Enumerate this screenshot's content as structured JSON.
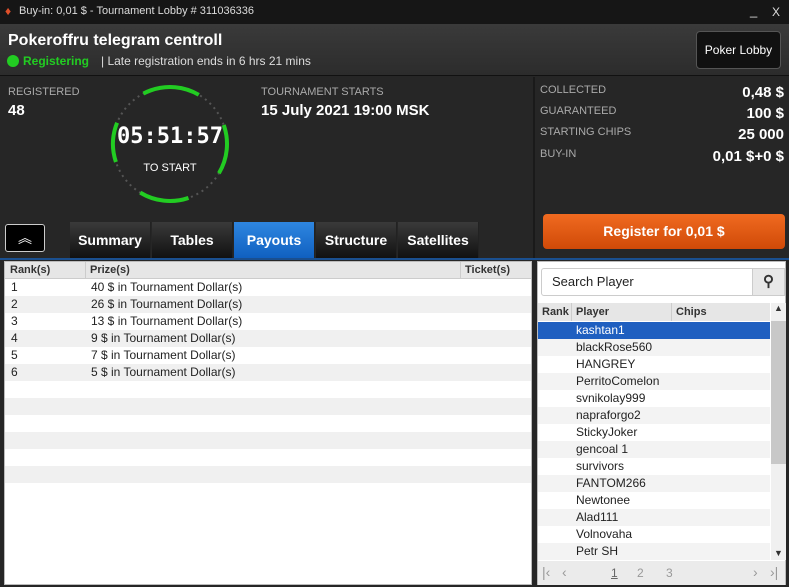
{
  "window": {
    "title": "Buy-in: 0,01 $ - Tournament Lobby # 311036336",
    "minimize": "_",
    "close": "X"
  },
  "header": {
    "name": "Pokeroffru telegram centroll",
    "status": "Registering",
    "late_reg": "| Late registration ends in 6 hrs  21 mins",
    "lobby_button": "Poker Lobby",
    "status_color": "#22cc22"
  },
  "info": {
    "registered_label": "REGISTERED",
    "registered": "48",
    "timer": "05:51:57",
    "timer_label": "TO START",
    "starts_label": "TOURNAMENT STARTS",
    "starts": "15 July 2021  19:00 MSK"
  },
  "stats": [
    {
      "label": "COLLECTED",
      "value": "0,48 $"
    },
    {
      "label": "GUARANTEED",
      "value": "100 $"
    },
    {
      "label": "STARTING CHIPS",
      "value": "25 000"
    },
    {
      "label": "BUY-IN",
      "value": "0,01 $+0 $"
    }
  ],
  "register_button": "Register for  0,01 $",
  "tabs": [
    {
      "label": "Summary"
    },
    {
      "label": "Tables"
    },
    {
      "label": "Payouts",
      "active": true
    },
    {
      "label": "Structure"
    },
    {
      "label": "Satellites"
    }
  ],
  "payouts": {
    "headers": [
      "Rank(s)",
      "Prize(s)",
      "Ticket(s)"
    ],
    "rows": [
      [
        "1",
        "40 $ in Tournament Dollar(s)"
      ],
      [
        "2",
        "26 $ in Tournament Dollar(s)"
      ],
      [
        "3",
        "13 $ in Tournament Dollar(s)"
      ],
      [
        "4",
        "9 $ in Tournament Dollar(s)"
      ],
      [
        "5",
        "7 $ in Tournament Dollar(s)"
      ],
      [
        "6",
        "5 $ in Tournament Dollar(s)"
      ]
    ]
  },
  "players": {
    "search_placeholder": "Search Player",
    "headers": [
      "Rank",
      "Player",
      "Chips"
    ],
    "rows": [
      "kashtan1",
      "blackRose560",
      "HANGREY",
      "PerritoComelon",
      "svnikolay999",
      "napraforgo2",
      "StickyJoker",
      "gencoal 1",
      "survivors",
      "FANTOM266",
      "Newtonee",
      "Alad111",
      "Volnovaha",
      "Petr SH"
    ],
    "pages": [
      "1",
      "2",
      "3"
    ],
    "current_page": "1"
  }
}
